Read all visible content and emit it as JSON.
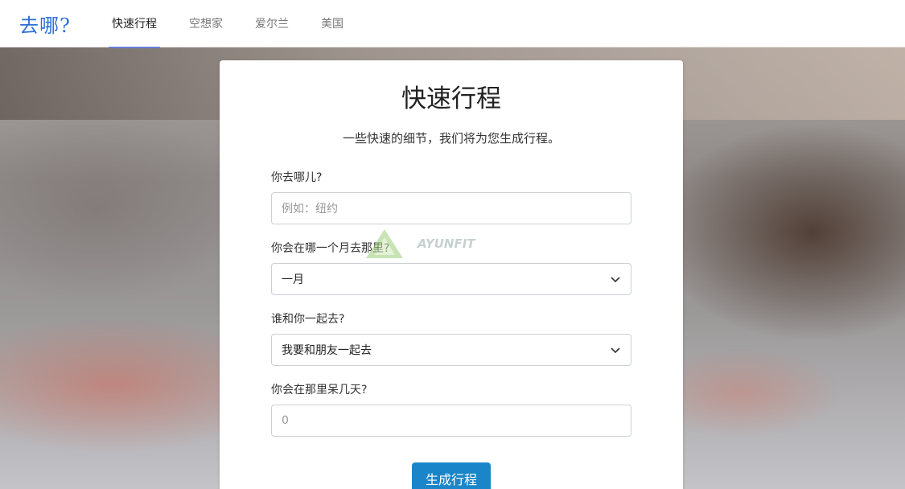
{
  "brand": "去哪?",
  "nav": [
    {
      "label": "快速行程",
      "active": true
    },
    {
      "label": "空想家",
      "active": false
    },
    {
      "label": "爱尔兰",
      "active": false
    },
    {
      "label": "美国",
      "active": false
    }
  ],
  "card": {
    "title": "快速行程",
    "subtitle": "一些快速的细节，我们将为您生成行程。",
    "fields": {
      "destination": {
        "label": "你去哪儿?",
        "placeholder": "例如：纽约"
      },
      "month": {
        "label": "你会在哪一个月去那里?",
        "value": "一月"
      },
      "companion": {
        "label": "谁和你一起去?",
        "value": "我要和朋友一起去"
      },
      "days": {
        "label": "你会在那里呆几天?",
        "placeholder": "0"
      }
    },
    "submit_label": "生成行程"
  },
  "watermark": "AYUNFIT",
  "colors": {
    "brand": "#2e6fd6",
    "button": "#1a86c9",
    "active_underline": "#6b7fd7"
  }
}
